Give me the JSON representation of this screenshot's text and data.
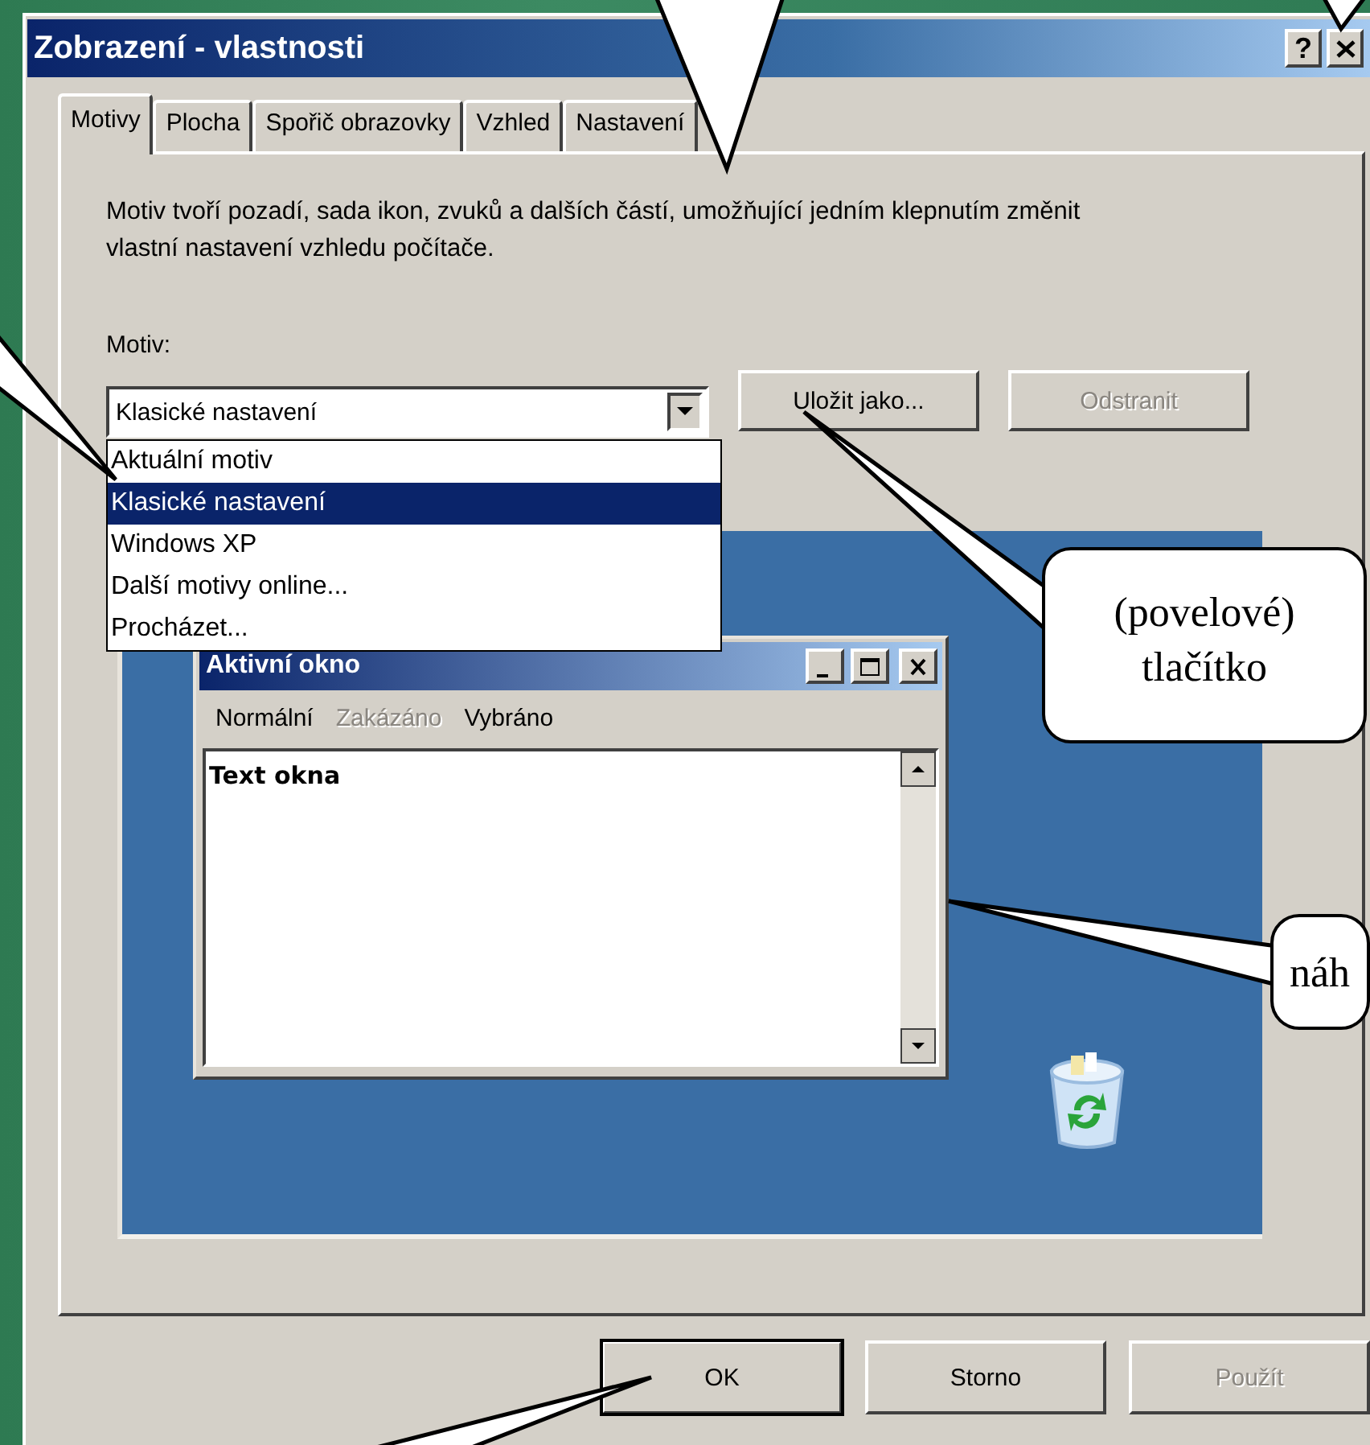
{
  "window": {
    "title": "Zobrazení - vlastnosti",
    "help_button": "?"
  },
  "tabs": [
    {
      "label": "Motivy",
      "selected": true
    },
    {
      "label": "Plocha",
      "selected": false
    },
    {
      "label": "Spořič obrazovky",
      "selected": false
    },
    {
      "label": "Vzhled",
      "selected": false
    },
    {
      "label": "Nastavení",
      "selected": false
    }
  ],
  "description": "Motiv tvoří pozadí, sada ikon, zvuků a dalších částí, umožňující jedním klepnutím změnit vlastní nastavení vzhledu počítače.",
  "theme": {
    "label": "Motiv:",
    "value": "Klasické nastavení",
    "expanded": true,
    "options": [
      {
        "label": "Aktuální motiv",
        "selected": false
      },
      {
        "label": "Klasické nastavení",
        "selected": true
      },
      {
        "label": "Windows XP",
        "selected": false
      },
      {
        "label": "Další motivy online...",
        "selected": false
      },
      {
        "label": "Procházet...",
        "selected": false
      }
    ]
  },
  "theme_buttons": [
    {
      "label": "Uložit jako...",
      "disabled": false
    },
    {
      "label": "Odstranit",
      "disabled": true
    }
  ],
  "preview": {
    "window_title": "Aktivní okno",
    "menu": [
      {
        "label": "Normální",
        "disabled": false
      },
      {
        "label": "Zakázáno",
        "disabled": true
      },
      {
        "label": "Vybráno",
        "disabled": false
      }
    ],
    "text": "Text okna"
  },
  "dialog_buttons": [
    {
      "label": "OK",
      "disabled": false,
      "default": true
    },
    {
      "label": "Storno",
      "disabled": false,
      "default": false
    },
    {
      "label": "Použít",
      "disabled": true,
      "default": false
    }
  ],
  "callouts": [
    {
      "text": "(povelové) tlačítko",
      "kind": "button"
    },
    {
      "text": "náh",
      "kind": "preview"
    }
  ]
}
